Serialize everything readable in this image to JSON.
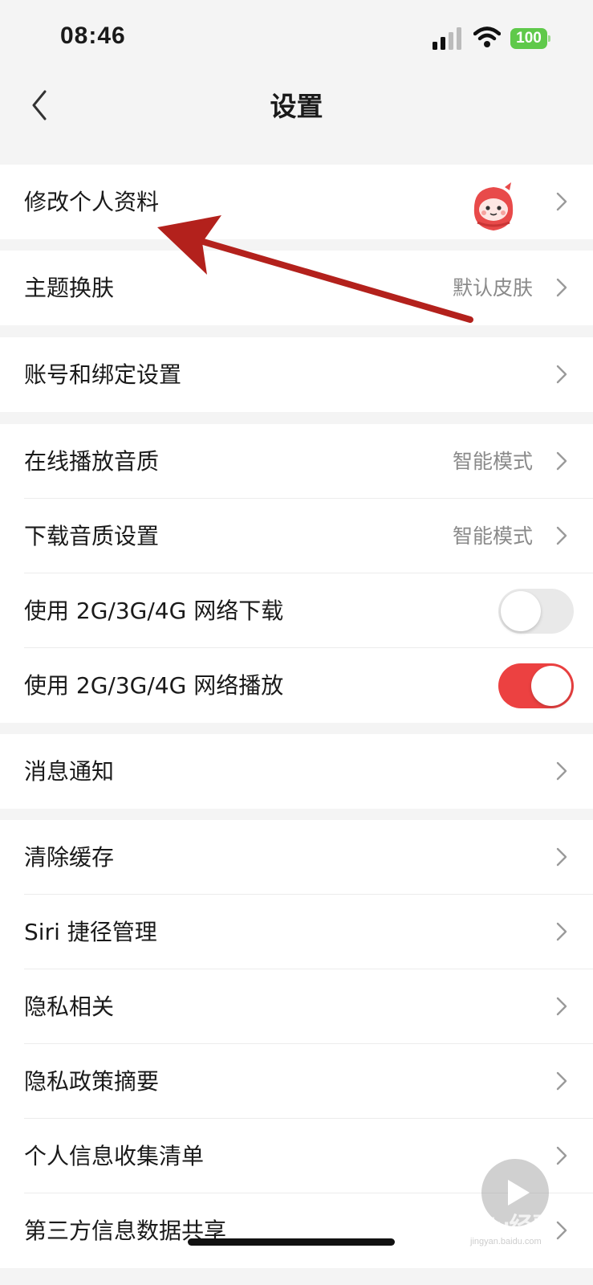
{
  "status_bar": {
    "time": "08:46",
    "battery": "100",
    "icons": [
      "signal-icon",
      "wifi-icon",
      "battery-icon"
    ]
  },
  "nav": {
    "title": "设置",
    "back_icon": "chevron-left-icon"
  },
  "groups": [
    {
      "rows": [
        {
          "label": "修改个人资料",
          "avatar": "profile-avatar",
          "chevron": true
        }
      ]
    },
    {
      "rows": [
        {
          "label": "主题换肤",
          "value": "默认皮肤",
          "chevron": true
        }
      ]
    },
    {
      "rows": [
        {
          "label": "账号和绑定设置",
          "chevron": true
        }
      ]
    },
    {
      "rows": [
        {
          "label": "在线播放音质",
          "value": "智能模式",
          "chevron": true
        },
        {
          "label": "下载音质设置",
          "value": "智能模式",
          "chevron": true
        },
        {
          "label": "使用 2G/3G/4G 网络下载",
          "toggle": false
        },
        {
          "label": "使用 2G/3G/4G 网络播放",
          "toggle": true
        }
      ]
    },
    {
      "rows": [
        {
          "label": "消息通知",
          "chevron": true
        }
      ]
    },
    {
      "rows": [
        {
          "label": "清除缓存",
          "chevron": true
        },
        {
          "label": "Siri 捷径管理",
          "chevron": true
        },
        {
          "label": "隐私相关",
          "chevron": true
        },
        {
          "label": "隐私政策摘要",
          "chevron": true
        },
        {
          "label": "个人信息收集清单",
          "chevron": true
        },
        {
          "label": "第三方信息数据共享",
          "chevron": true
        }
      ]
    }
  ],
  "overlay": {
    "watermark": "Baidu经验",
    "watermark_sub": "jingyan.baidu.com"
  },
  "colors": {
    "accent": "#ec4141",
    "annotation_arrow": "#c0201c",
    "battery": "#5fc94a",
    "background": "#f4f4f4"
  }
}
